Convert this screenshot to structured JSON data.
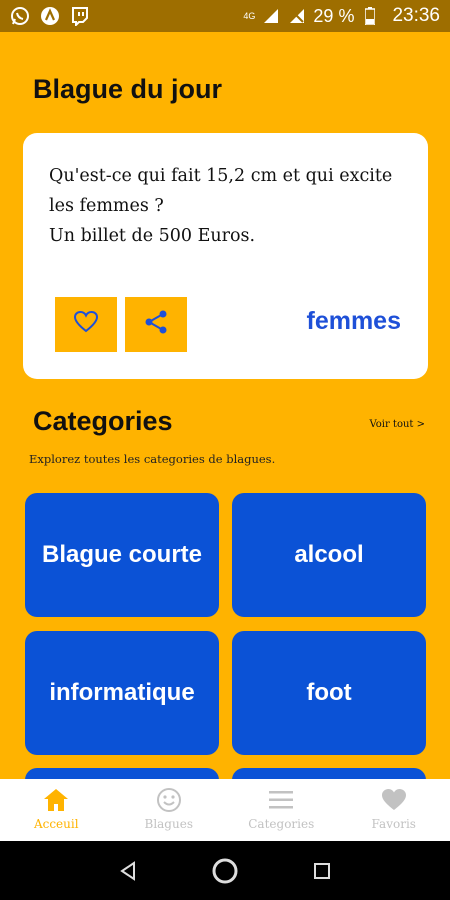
{
  "status_bar": {
    "network": "4G",
    "battery": "29 %",
    "time": "23:36",
    "icons": [
      "whatsapp-icon",
      "app-icon",
      "twitch-icon",
      "signal-icon",
      "battery-icon"
    ]
  },
  "joke_of_day": {
    "title": "Blague du jour",
    "text": "Qu'est-ce qui fait 15,2 cm et qui excite les femmes ?\nUn billet de 500 Euros.",
    "category": "femmes",
    "favorite_icon": "heart-outline-icon",
    "share_icon": "share-icon"
  },
  "categories": {
    "title": "Categories",
    "see_all": "Voir tout >",
    "subtitle": "Explorez toutes les categories de blagues.",
    "items": [
      {
        "label": "Blague courte"
      },
      {
        "label": "alcool"
      },
      {
        "label": "informatique"
      },
      {
        "label": "foot"
      },
      {
        "label": ""
      },
      {
        "label": ""
      }
    ]
  },
  "bottom_nav": {
    "items": [
      {
        "label": "Acceuil",
        "icon": "home-icon",
        "active": true
      },
      {
        "label": "Blagues",
        "icon": "smiley-icon",
        "active": false
      },
      {
        "label": "Categories",
        "icon": "menu-icon",
        "active": false
      },
      {
        "label": "Favoris",
        "icon": "heart-icon",
        "active": false
      }
    ]
  },
  "colors": {
    "background": "#FFB300",
    "status_bar": "#9E6E00",
    "tile": "#0B52D6",
    "category_text": "#1E50D8",
    "nav_active": "#FFB300",
    "nav_inactive": "#C2C2C2"
  }
}
